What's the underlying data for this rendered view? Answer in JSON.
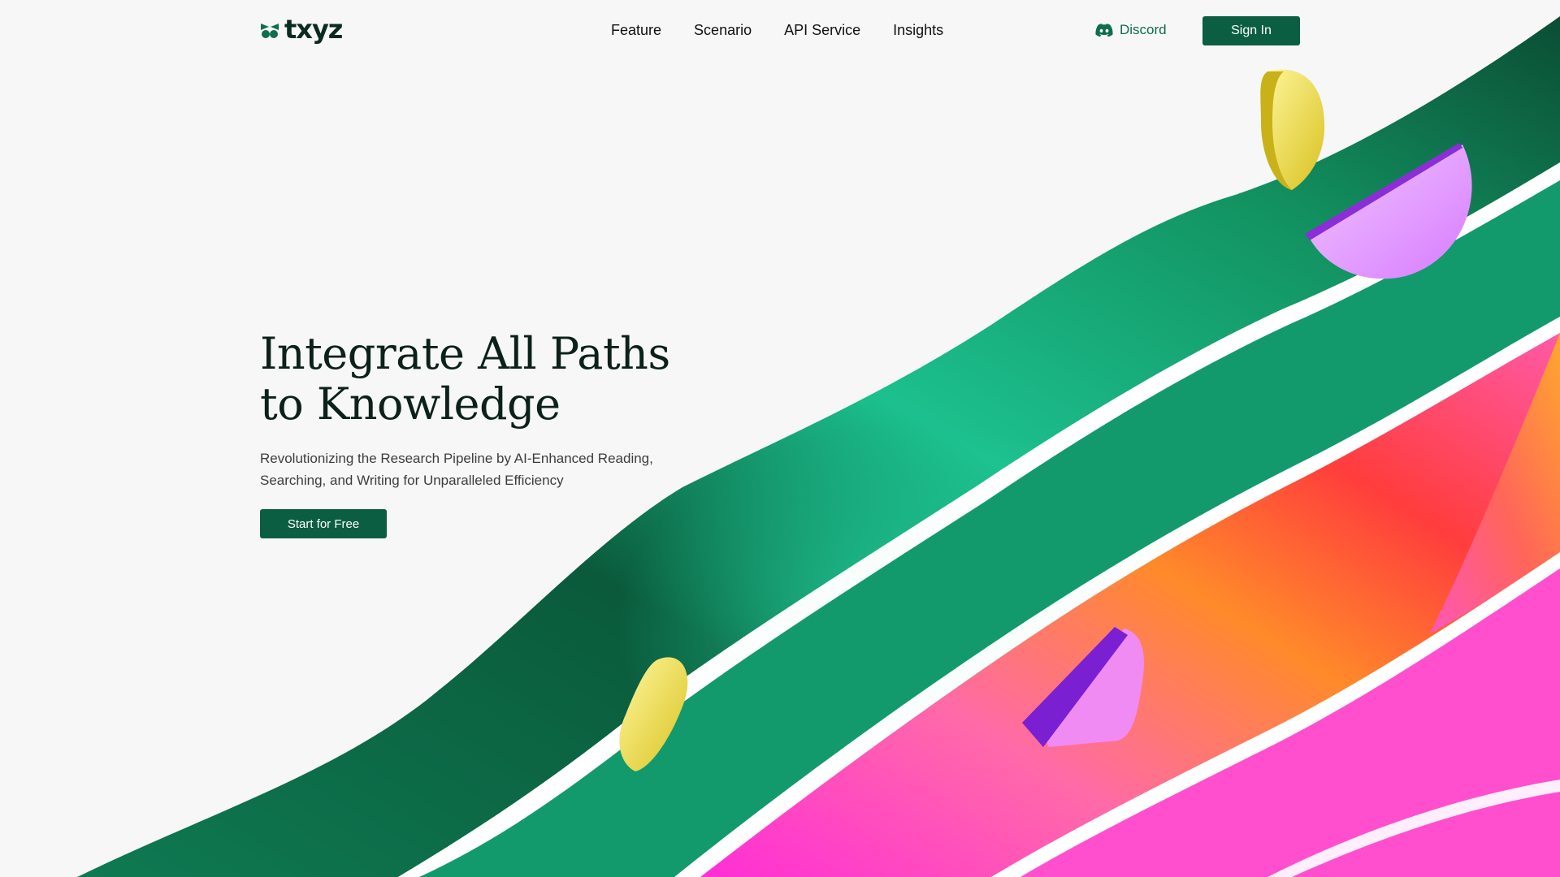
{
  "brand": {
    "name": "txyz",
    "logo_icon": "leaf-cluster-icon",
    "color": "#0c5e43"
  },
  "nav": {
    "items": [
      {
        "label": "Feature"
      },
      {
        "label": "Scenario"
      },
      {
        "label": "API Service"
      },
      {
        "label": "Insights"
      }
    ]
  },
  "header": {
    "discord_label": "Discord",
    "discord_icon": "discord-icon",
    "signin_label": "Sign In"
  },
  "hero": {
    "title_line1": "Integrate All Paths",
    "title_line2": "to Knowledge",
    "subtitle": "Revolutionizing the Research Pipeline by AI-Enhanced Reading, Searching, and Writing for Unparalleled Efficiency",
    "cta_label": "Start for Free"
  },
  "colors": {
    "background": "#f7f7f7",
    "green_ribbon": "#139a6c",
    "gradient_ribbon_top": "#ff9a2e",
    "gradient_ribbon_bottom": "#ff3fd8",
    "yellow_shape": "#f2e44a",
    "purple_shape": "#b24ef0"
  }
}
